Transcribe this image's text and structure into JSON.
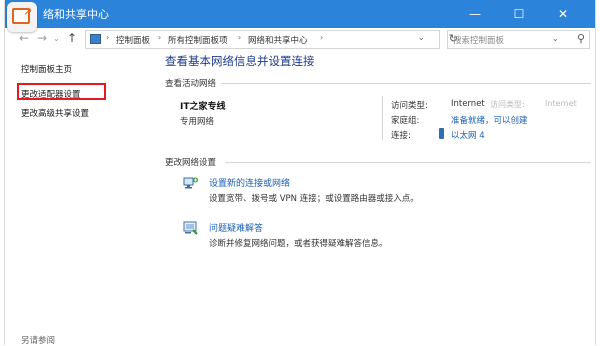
{
  "window": {
    "title": "络和共享中心",
    "minimize": "—",
    "maximize": "☐",
    "close": "✕"
  },
  "nav": {
    "back": "←",
    "forward": "→",
    "history": "⌄",
    "up": "↑",
    "breadcrumbs": [
      "控制面板",
      "所有控制面板项",
      "网络和共享中心"
    ],
    "separator": "›",
    "dropdown": "⌄",
    "refresh": "↻",
    "search_placeholder": "搜索控制面板",
    "search_drop": "⌄",
    "search_icon": "⚲"
  },
  "sidebar": {
    "home": "控制面板主页",
    "change_adapter": "更改适配器设置",
    "advanced_sharing": "更改高级共享设置",
    "see_also": "另请参阅"
  },
  "main": {
    "heading": "查看基本网络信息并设置连接",
    "active_networks_title": "查看活动网络",
    "network_name": "IT之家专线",
    "network_type": "专用网络",
    "access_type_label": "访问类型:",
    "access_type_value": "Internet",
    "homegroup_label": "家庭组:",
    "homegroup_value": "准备就绪，可以创建",
    "connections_label": "连接:",
    "connections_value": "以太网 4",
    "faint_access_type": "访问类型:",
    "faint_internet": "Internet",
    "change_settings_title": "更改网络设置",
    "tasks": [
      {
        "link": "设置新的连接或网络",
        "desc": "设置宽带、拨号或 VPN 连接；或设置路由器或接入点。",
        "icon": "network-setup-icon"
      },
      {
        "link": "问题疑难解答",
        "desc": "诊断并修复网络问题，或者获得疑难解答信息。",
        "icon": "troubleshoot-icon"
      }
    ]
  },
  "colors": {
    "titlebar": "#2b84d9",
    "link": "#1b5fb5",
    "highlight_box": "#e21b22",
    "app_badge": "#e0651c"
  }
}
